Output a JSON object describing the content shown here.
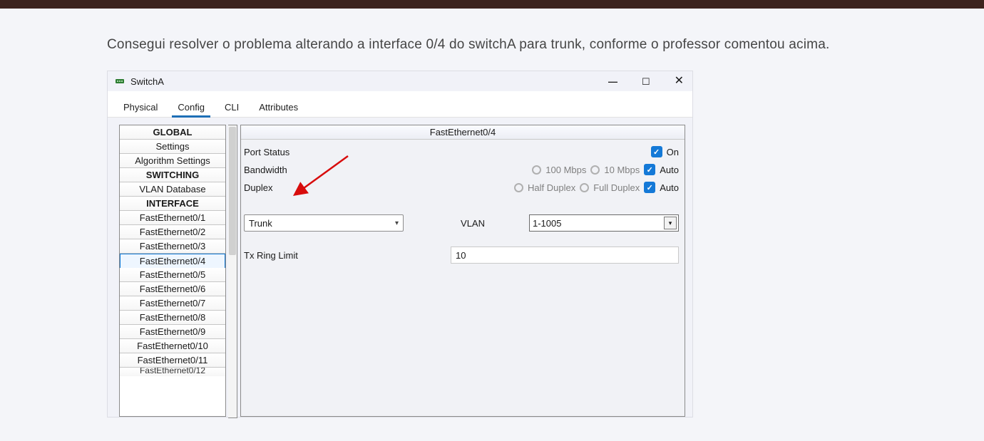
{
  "comment": "Consegui resolver o problema alterando a interface 0/4 do switchA para trunk, conforme o professor comentou acima.",
  "window": {
    "title": "SwitchA",
    "tabs": [
      "Physical",
      "Config",
      "CLI",
      "Attributes"
    ],
    "active_tab_index": 1,
    "sidebar": {
      "groups": [
        {
          "header": "GLOBAL",
          "items": [
            "Settings",
            "Algorithm Settings"
          ]
        },
        {
          "header": "SWITCHING",
          "items": [
            "VLAN Database"
          ]
        },
        {
          "header": "INTERFACE",
          "items": [
            "FastEthernet0/1",
            "FastEthernet0/2",
            "FastEthernet0/3",
            "FastEthernet0/4",
            "FastEthernet0/5",
            "FastEthernet0/6",
            "FastEthernet0/7",
            "FastEthernet0/8",
            "FastEthernet0/9",
            "FastEthernet0/10",
            "FastEthernet0/11"
          ],
          "partial_next": "FastEthernet0/12"
        }
      ],
      "selected": "FastEthernet0/4"
    },
    "details": {
      "header": "FastEthernet0/4",
      "port_status": {
        "label": "Port Status",
        "on_label": "On",
        "on": true
      },
      "bandwidth": {
        "label": "Bandwidth",
        "options": [
          {
            "label": "100 Mbps",
            "checked": false
          },
          {
            "label": "10 Mbps",
            "checked": false
          }
        ],
        "auto_label": "Auto",
        "auto_checked": true
      },
      "duplex": {
        "label": "Duplex",
        "options": [
          {
            "label": "Half Duplex",
            "checked": false
          },
          {
            "label": "Full Duplex",
            "checked": false
          }
        ],
        "auto_label": "Auto",
        "auto_checked": true
      },
      "mode": {
        "value": "Trunk"
      },
      "vlan": {
        "label": "VLAN",
        "value": "1-1005"
      },
      "tx_ring": {
        "label": "Tx Ring Limit",
        "value": "10"
      }
    }
  }
}
